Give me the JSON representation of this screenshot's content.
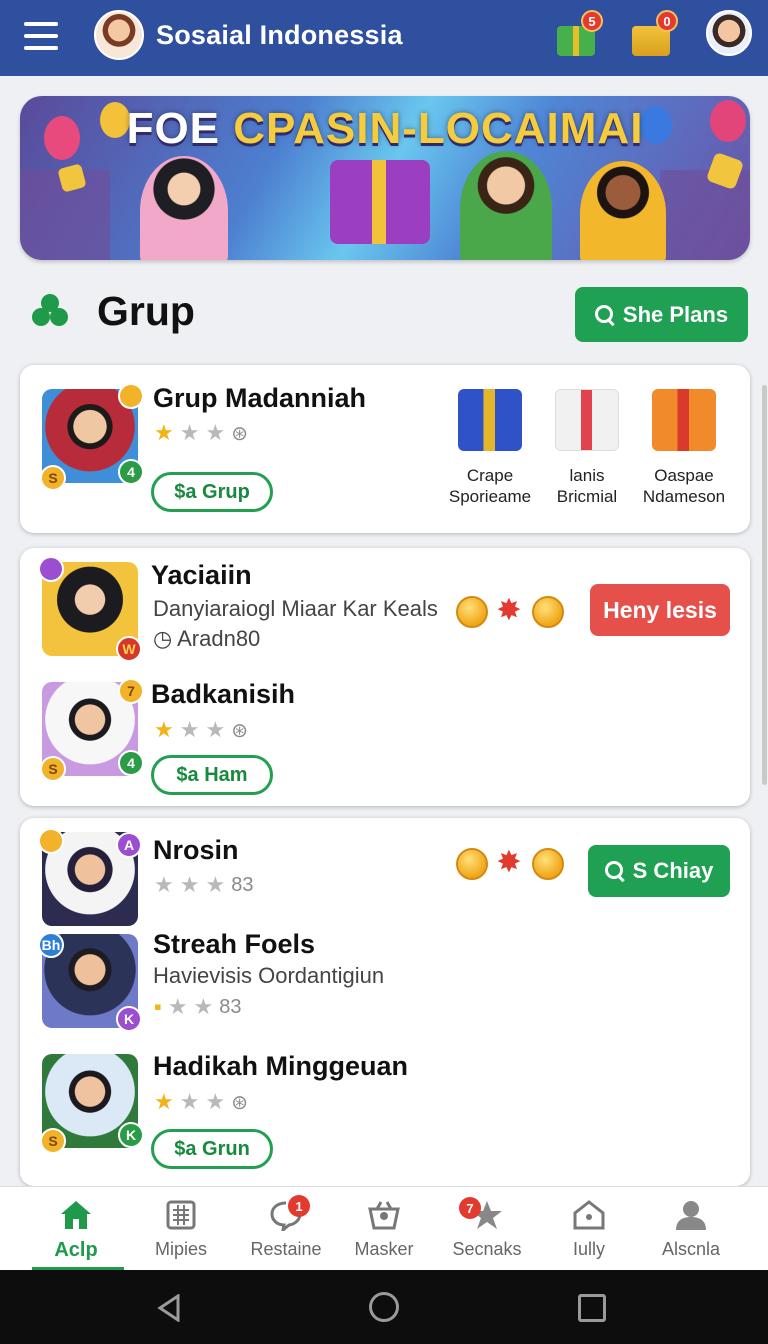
{
  "app": {
    "title": "Sosaial Indonessia",
    "gift_badge": "5",
    "box_badge": "0"
  },
  "banner": {
    "title_part1": "FOE ",
    "title_part2": "CPASIN-LOCAIMAI"
  },
  "section": {
    "title": "Grup",
    "search_button": "She Plans",
    "icon": "group-icon"
  },
  "card1": {
    "name": "Grup Madanniah",
    "avatar_badges": [
      "",
      "S",
      "4"
    ],
    "rating": 1,
    "join_label": "$a Grup",
    "gifts": [
      {
        "line1": "Crape",
        "line2": "Sporieame",
        "color": "#2f52c8"
      },
      {
        "line1": "lanis",
        "line2": "Bricmial",
        "color": "#f4f4f4"
      },
      {
        "line1": "Oasрae",
        "line2": "Ndameson",
        "color": "#f08a2a"
      }
    ]
  },
  "card2": {
    "items": [
      {
        "name": "Yaciaiin",
        "sub": "Danyiaraiogl Miaar Kar Keals",
        "meta": "Aradn80",
        "badges": [
          "",
          "W"
        ]
      },
      {
        "name": "Badkanisih",
        "rating": 1,
        "join_label": "$a Ham",
        "badges": [
          "7",
          "S",
          "4"
        ]
      }
    ],
    "action_button": "Heny lesis"
  },
  "card3": {
    "items": [
      {
        "name": "Nrosin",
        "extra": "83",
        "badges": [
          "",
          "A"
        ]
      },
      {
        "name": "Streah Foels",
        "sub": "Havievisis Oordantigiun",
        "extra": "83",
        "badges": [
          "Bh",
          "K"
        ]
      },
      {
        "name": "Hadikah Minggeuan",
        "rating": 1,
        "join_label": "$a Grun",
        "badges": [
          "",
          "S",
          "K"
        ]
      }
    ],
    "chat_button": "S Chiay"
  },
  "nav": [
    {
      "label": "Aclp",
      "icon": "home-icon",
      "active": true
    },
    {
      "label": "Mipies",
      "icon": "grid-icon"
    },
    {
      "label": "Restaine",
      "icon": "chat-bubble-icon",
      "badge": "1"
    },
    {
      "label": "Masker",
      "icon": "basket-icon"
    },
    {
      "label": "Secnaks",
      "icon": "star-icon",
      "badge": "7"
    },
    {
      "label": "Iully",
      "icon": "house-icon"
    },
    {
      "label": "Alscnla",
      "icon": "profile-icon"
    }
  ],
  "colors": {
    "appbar": "#2f4f9f",
    "accent_green": "#20a052",
    "danger_red": "#e5514a"
  }
}
